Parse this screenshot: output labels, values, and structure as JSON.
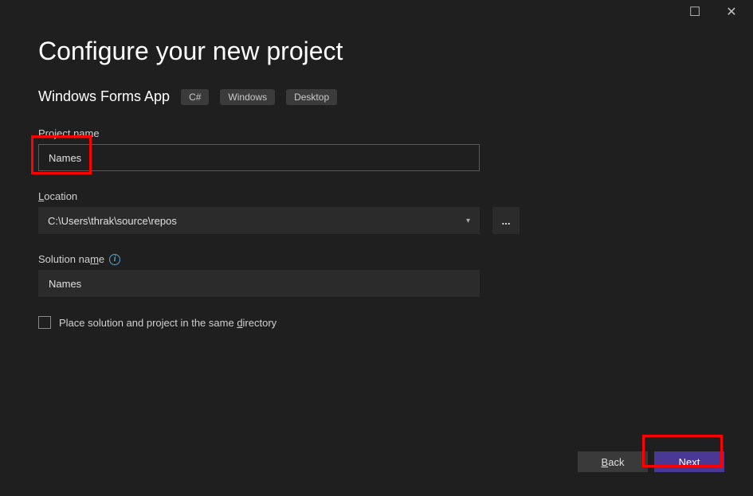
{
  "titleBar": {
    "maximizeGlyph": "☐",
    "closeGlyph": "✕"
  },
  "header": {
    "title": "Configure your new project",
    "templateName": "Windows Forms App",
    "tags": [
      "C#",
      "Windows",
      "Desktop"
    ]
  },
  "fields": {
    "projectName": {
      "label": "Project name",
      "value": "Names"
    },
    "location": {
      "labelPrefix": "L",
      "labelRest": "ocation",
      "value": "C:\\Users\\thrak\\source\\repos",
      "browseLabel": "..."
    },
    "solutionName": {
      "labelPrefix": "Solution na",
      "labelUnderline": "m",
      "labelSuffix": "e",
      "infoGlyph": "i",
      "value": "Names"
    },
    "sameDir": {
      "checked": false,
      "labelPrefix": "Place solution and project in the same ",
      "labelUnderline": "d",
      "labelSuffix": "irectory"
    }
  },
  "footer": {
    "backPrefix": "B",
    "backRest": "ack",
    "nextPrefix": "N",
    "nextRest": "ext"
  }
}
